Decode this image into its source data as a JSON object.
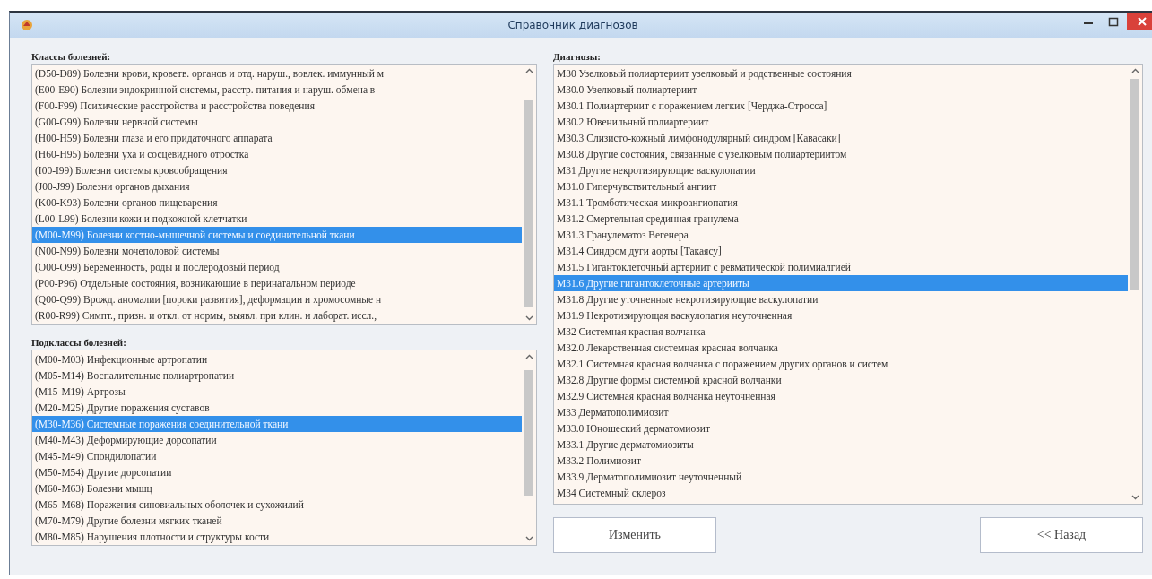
{
  "window": {
    "title": "Справочник диагнозов"
  },
  "classes": {
    "label": "Классы болезней:",
    "items": [
      {
        "text": "(D50-D89) Болезни крови, кроветв. органов и отд. наруш., вовлек. иммунный м",
        "selected": false
      },
      {
        "text": "(E00-E90) Болезни эндокринной системы, расстр. питания и наруш. обмена в",
        "selected": false
      },
      {
        "text": "(F00-F99) Психические расстройства и расстройства поведения",
        "selected": false
      },
      {
        "text": "(G00-G99) Болезни нервной системы",
        "selected": false
      },
      {
        "text": "(H00-H59) Болезни глаза и его придаточного аппарата",
        "selected": false
      },
      {
        "text": "(H60-H95) Болезни уха и сосцевидного отростка",
        "selected": false
      },
      {
        "text": "(I00-I99) Болезни системы кровообращения",
        "selected": false
      },
      {
        "text": "(J00-J99) Болезни органов дыхания",
        "selected": false
      },
      {
        "text": "(K00-K93) Болезни органов пищеварения",
        "selected": false
      },
      {
        "text": "(L00-L99) Болезни кожи и подкожной клетчатки",
        "selected": false
      },
      {
        "text": "(M00-M99) Болезни костно-мышечной системы и соединительной ткани",
        "selected": true
      },
      {
        "text": "(N00-N99) Болезни мочеполовой системы",
        "selected": false
      },
      {
        "text": "(O00-O99) Беременность, роды и послеродовый период",
        "selected": false
      },
      {
        "text": "(P00-P96) Отдельные состояния, возникающие в перинатальном периоде",
        "selected": false
      },
      {
        "text": "(Q00-Q99) Врожд. аномалии [пороки развития], деформации и хромосомные н",
        "selected": false
      },
      {
        "text": "(R00-R99) Симпт., призн. и откл. от нормы, выявл. при клин. и лаборат. иссл.,",
        "selected": false
      }
    ]
  },
  "subclasses": {
    "label": "Подклассы болезней:",
    "items": [
      {
        "text": "(M00-M03) Инфекционные артропатии",
        "selected": false
      },
      {
        "text": "(M05-M14) Воспалительные полиартропатии",
        "selected": false
      },
      {
        "text": "(M15-M19) Артрозы",
        "selected": false
      },
      {
        "text": "(M20-M25) Другие поражения суставов",
        "selected": false
      },
      {
        "text": "(M30-M36) Системные поражения соединительной ткани",
        "selected": true
      },
      {
        "text": "(M40-M43) Деформирующие дорсопатии",
        "selected": false
      },
      {
        "text": "(M45-M49) Спондилопатии",
        "selected": false
      },
      {
        "text": "(M50-M54) Другие дорсопатии",
        "selected": false
      },
      {
        "text": "(M60-M63) Болезни мышц",
        "selected": false
      },
      {
        "text": "(M65-M68) Поражения синовиальных оболочек и сухожилий",
        "selected": false
      },
      {
        "text": "(M70-M79) Другие болезни мягких тканей",
        "selected": false
      },
      {
        "text": "(M80-M85) Нарушения плотности и структуры кости",
        "selected": false
      }
    ]
  },
  "diagnoses": {
    "label": "Диагнозы:",
    "items": [
      {
        "text": "M30 Узелковый полиартериит узелковый и родственные состояния",
        "selected": false
      },
      {
        "text": "M30.0 Узелковый полиартериит",
        "selected": false
      },
      {
        "text": "M30.1 Полиартериит с поражением легких [Черджа-Стросса]",
        "selected": false
      },
      {
        "text": "M30.2 Ювенильный полиартериит",
        "selected": false
      },
      {
        "text": "M30.3 Слизисто-кожный лимфонодулярный синдром [Кавасаки]",
        "selected": false
      },
      {
        "text": "M30.8 Другие состояния, связанные с узелковым полиартериитом",
        "selected": false
      },
      {
        "text": "M31 Другие некротизирующие васкулопатии",
        "selected": false
      },
      {
        "text": "M31.0 Гиперчувствительный ангиит",
        "selected": false
      },
      {
        "text": "M31.1 Тромботическая микроангиопатия",
        "selected": false
      },
      {
        "text": "M31.2 Смертельная срединная гранулема",
        "selected": false
      },
      {
        "text": "M31.3 Гранулематоз Вегенера",
        "selected": false
      },
      {
        "text": "M31.4 Синдром дуги аорты [Такаясу]",
        "selected": false
      },
      {
        "text": "M31.5 Гигантоклеточный артериит с ревматической полимиалгией",
        "selected": false
      },
      {
        "text": "M31.6 Другие гигантоклеточные артерииты",
        "selected": true
      },
      {
        "text": "M31.8 Другие уточненные некротизирующие васкулопатии",
        "selected": false
      },
      {
        "text": "M31.9 Некротизирующая васкулопатия неуточненная",
        "selected": false
      },
      {
        "text": "M32 Системная красная волчанка",
        "selected": false
      },
      {
        "text": "M32.0 Лекарственная системная красная волчанка",
        "selected": false
      },
      {
        "text": "M32.1 Системная красная волчанка с поражением других органов и систем",
        "selected": false
      },
      {
        "text": "M32.8 Другие формы системной красной волчанки",
        "selected": false
      },
      {
        "text": "M32.9 Системная красная волчанка неуточненная",
        "selected": false
      },
      {
        "text": "M33 Дерматополимиозит",
        "selected": false
      },
      {
        "text": "M33.0 Юношеский дерматомиозит",
        "selected": false
      },
      {
        "text": "M33.1 Другие дерматомиозиты",
        "selected": false
      },
      {
        "text": "M33.2 Полимиозит",
        "selected": false
      },
      {
        "text": "M33.9 Дерматополимиозит неуточненный",
        "selected": false
      },
      {
        "text": "M34 Системный склероз",
        "selected": false
      }
    ]
  },
  "buttons": [
    {
      "label": "Изменить"
    },
    {
      "label": "<< Назад"
    }
  ]
}
